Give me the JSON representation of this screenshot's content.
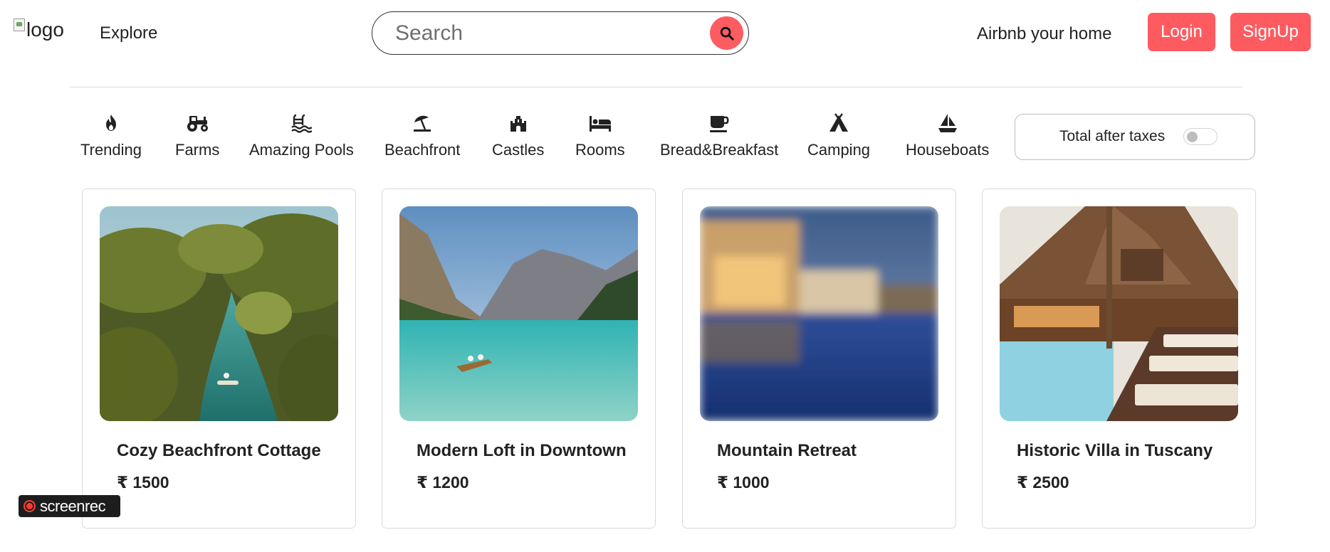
{
  "navbar": {
    "logo_alt": "logo",
    "explore_label": "Explore",
    "search_placeholder": "Search",
    "host_label": "Airbnb your home",
    "login_label": "Login",
    "signup_label": "SignUp"
  },
  "colors": {
    "accent": "#fe5b60",
    "text": "#222222",
    "border": "#dadada"
  },
  "filters": [
    {
      "label": "Trending",
      "icon": "fire-icon"
    },
    {
      "label": "Farms",
      "icon": "tractor-icon"
    },
    {
      "label": "Amazing Pools",
      "icon": "pool-icon"
    },
    {
      "label": "Beachfront",
      "icon": "umbrella-beach-icon"
    },
    {
      "label": "Castles",
      "icon": "castle-icon"
    },
    {
      "label": "Rooms",
      "icon": "bed-icon"
    },
    {
      "label": "Bread&Breakfast",
      "icon": "mug-icon"
    },
    {
      "label": "Camping",
      "icon": "tent-icon"
    },
    {
      "label": "Houseboats",
      "icon": "sailboat-icon"
    }
  ],
  "tax_toggle": {
    "label": "Total after taxes",
    "enabled": false
  },
  "listings": [
    {
      "title": "Cozy Beachfront Cottage",
      "price": "₹ 1500",
      "image": "tropical river with palm trees and boat"
    },
    {
      "title": "Modern Loft in Downtown",
      "price": "₹ 1200",
      "image": "turquoise mountain lake with rowboat"
    },
    {
      "title": "Mountain Retreat",
      "price": "₹ 1000",
      "image": "blurred resort pool at dusk"
    },
    {
      "title": "Historic Villa in Tuscany",
      "price": "₹ 2500",
      "image": "wooden villa with pool and sun loungers"
    }
  ],
  "overlay": {
    "recorder_label": "screenrec"
  }
}
